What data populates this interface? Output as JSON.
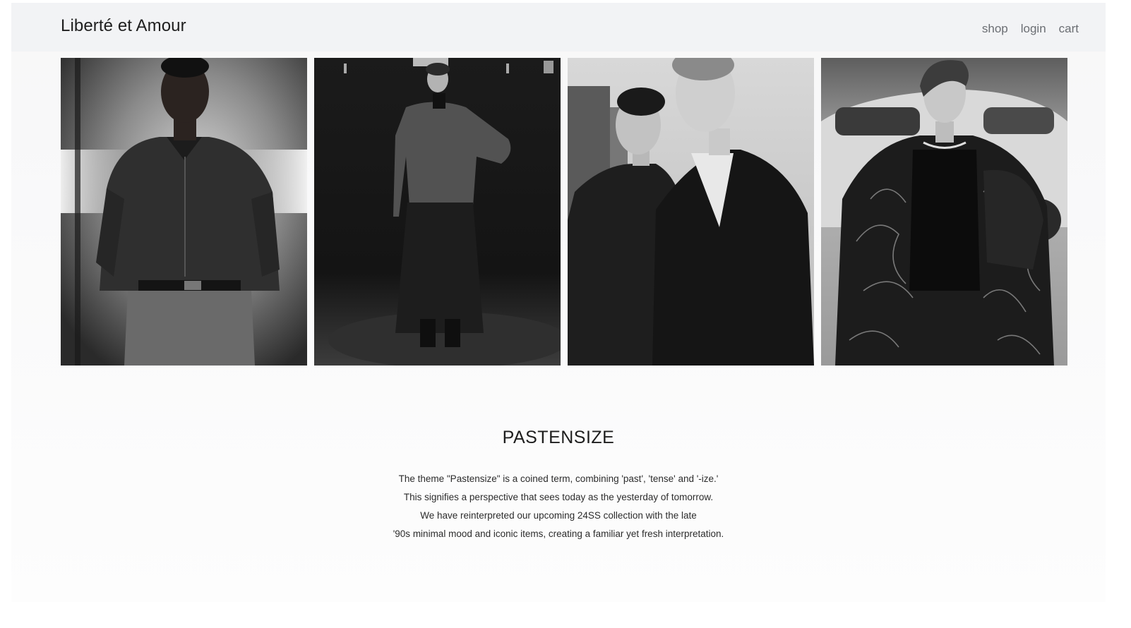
{
  "header": {
    "brand": "Liberté et Amour",
    "nav": [
      {
        "label": "shop"
      },
      {
        "label": "login"
      },
      {
        "label": "cart"
      }
    ]
  },
  "gallery": {
    "photos": [
      {
        "subject": "man in dark western shirt against light background"
      },
      {
        "subject": "woman in knit sweater and long skirt in dark hallway"
      },
      {
        "subject": "two men in dark jackets outdoors"
      },
      {
        "subject": "woman in patterned coat on street"
      }
    ]
  },
  "collection": {
    "title": "PASTENSIZE",
    "lines": [
      "The theme \"Pastensize\" is a coined term, combining 'past', 'tense' and '-ize.'",
      "This signifies a perspective that sees today as the yesterday of tomorrow.",
      "We have reinterpreted our upcoming 24SS collection with the late",
      "'90s minimal mood and iconic items, creating a familiar yet fresh interpretation."
    ]
  },
  "colors": {
    "navbar_bg": "#f2f3f5",
    "page_bg": "#f9f9fa",
    "text": "#1e1e1e",
    "nav_text": "#6b6e73"
  }
}
